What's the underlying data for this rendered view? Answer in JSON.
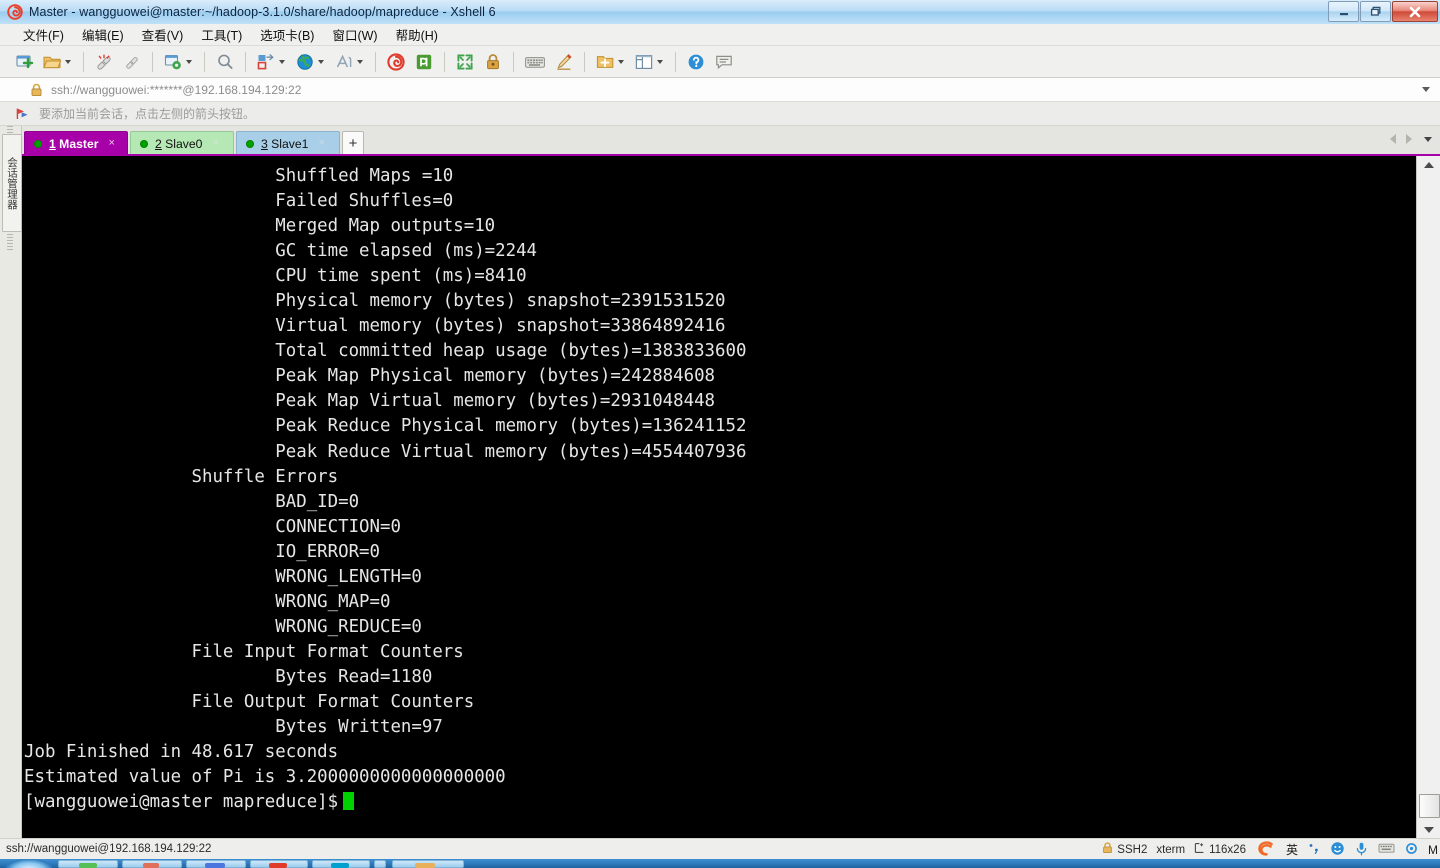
{
  "window": {
    "title": "Master - wangguowei@master:~/hadoop-3.1.0/share/hadoop/mapreduce - Xshell 6",
    "app_logo_icon": "xshell-spiral-logo-icon",
    "minimize_label": "–",
    "restore_label": "❐",
    "close_label": "✕"
  },
  "menubar": {
    "items": [
      {
        "label": "文件(F)",
        "name": "menu-file"
      },
      {
        "label": "编辑(E)",
        "name": "menu-edit"
      },
      {
        "label": "查看(V)",
        "name": "menu-view"
      },
      {
        "label": "工具(T)",
        "name": "menu-tools"
      },
      {
        "label": "选项卡(B)",
        "name": "menu-tabs"
      },
      {
        "label": "窗口(W)",
        "name": "menu-window"
      },
      {
        "label": "帮助(H)",
        "name": "menu-help"
      }
    ]
  },
  "toolbar": {
    "buttons": [
      {
        "name": "new-session-icon",
        "icon": "new-session",
        "has_caret": false
      },
      {
        "name": "open-folder-icon",
        "icon": "open-folder",
        "has_caret": true
      },
      {
        "sep": true
      },
      {
        "name": "disconnect-icon",
        "icon": "disconnect",
        "has_caret": false
      },
      {
        "name": "reconnect-icon",
        "icon": "reconnect-chain",
        "has_caret": false
      },
      {
        "sep": true
      },
      {
        "name": "session-properties-icon",
        "icon": "properties-gear",
        "has_caret": true
      },
      {
        "sep": true
      },
      {
        "name": "find-icon",
        "icon": "magnifier",
        "has_caret": false
      },
      {
        "sep": true
      },
      {
        "name": "transfer-icon",
        "icon": "file-transfer",
        "has_caret": true
      },
      {
        "name": "globe-icon",
        "icon": "globe",
        "has_caret": true
      },
      {
        "name": "font-icon",
        "icon": "font-A",
        "has_caret": true
      },
      {
        "sep": true
      },
      {
        "name": "xshell-icon",
        "icon": "xshell-spiral",
        "has_caret": false
      },
      {
        "name": "xftp-icon",
        "icon": "xftp-green",
        "has_caret": false
      },
      {
        "sep": true
      },
      {
        "name": "fullscreen-icon",
        "icon": "fullscreen-arrows",
        "has_caret": false
      },
      {
        "name": "lock-icon",
        "icon": "padlock",
        "has_caret": false
      },
      {
        "sep": true
      },
      {
        "name": "keyboard-icon",
        "icon": "keyboard",
        "has_caret": false
      },
      {
        "name": "highlight-pen-icon",
        "icon": "pen-highlight",
        "has_caret": false
      },
      {
        "sep": true
      },
      {
        "name": "add-to-folder-icon",
        "icon": "folder-plus",
        "has_caret": true
      },
      {
        "name": "layout-icon",
        "icon": "split-layout",
        "has_caret": true
      },
      {
        "sep": true
      },
      {
        "name": "help-icon",
        "icon": "help-question",
        "has_caret": false
      },
      {
        "name": "feedback-icon",
        "icon": "speech-bubble",
        "has_caret": false
      }
    ]
  },
  "address_bar": {
    "lock_icon": "padlock-icon",
    "value": "ssh://wangguowei:*******@192.168.194.129:22",
    "placeholder": "ssh://",
    "dropdown_icon": "chevron-down-icon"
  },
  "notice_bar": {
    "icon": "bookmark-flag-icon",
    "text": "要添加当前会话，点击左侧的箭头按钮。"
  },
  "left_rail": {
    "panel_label": "会话管理器"
  },
  "tabbar": {
    "tabs": [
      {
        "index": "1",
        "label": "Master",
        "color": "#a800a8",
        "active": true,
        "close_label": "×",
        "status": "connected"
      },
      {
        "index": "2",
        "label": "Slave0",
        "color": "#b5e8b5",
        "active": false,
        "close_label": "×",
        "status": "connected"
      },
      {
        "index": "3",
        "label": "Slave1",
        "color": "#a9cfe8",
        "active": false,
        "close_label": "×",
        "status": "connected"
      }
    ],
    "new_tab_label": "+",
    "prev_icon": "triangle-left-icon",
    "next_icon": "triangle-right-icon",
    "menu_icon": "chevron-down-icon",
    "accent_color": "#a800a8"
  },
  "terminal": {
    "rows": 26,
    "cols": 116,
    "background": "#000000",
    "foreground": "#e6e6e6",
    "cursor_color": "#00d200",
    "lines": [
      "                        Shuffled Maps =10",
      "                        Failed Shuffles=0",
      "                        Merged Map outputs=10",
      "                        GC time elapsed (ms)=2244",
      "                        CPU time spent (ms)=8410",
      "                        Physical memory (bytes) snapshot=2391531520",
      "                        Virtual memory (bytes) snapshot=33864892416",
      "                        Total committed heap usage (bytes)=1383833600",
      "                        Peak Map Physical memory (bytes)=242884608",
      "                        Peak Map Virtual memory (bytes)=2931048448",
      "                        Peak Reduce Physical memory (bytes)=136241152",
      "                        Peak Reduce Virtual memory (bytes)=4554407936",
      "                Shuffle Errors",
      "                        BAD_ID=0",
      "                        CONNECTION=0",
      "                        IO_ERROR=0",
      "                        WRONG_LENGTH=0",
      "                        WRONG_MAP=0",
      "                        WRONG_REDUCE=0",
      "                File Input Format Counters ",
      "                        Bytes Read=1180",
      "                File Output Format Counters ",
      "                        Bytes Written=97",
      "Job Finished in 48.617 seconds",
      "Estimated value of Pi is 3.2000000000000000000"
    ],
    "prompt": "[wangguowei@master mapreduce]$"
  },
  "scrollbar": {
    "up_icon": "arrow-up-icon",
    "down_icon": "arrow-down-icon",
    "thumb_position": "bottom"
  },
  "statusbar": {
    "connection": "ssh://wangguowei@192.168.194.129:22",
    "lock_icon": "padlock-icon",
    "protocol": "SSH2",
    "term_type": "xterm",
    "size_icon": "resize-icon",
    "size": "116x26",
    "ime_logo_icon": "sogou-ime-icon",
    "ime_mode": "英",
    "ime_punct_icon": "punctuation-icon",
    "ime_face_icon": "emoji-icon",
    "ime_voice_icon": "voice-input-icon",
    "ime_keyboard_icon": "soft-keyboard-icon",
    "ime_settings_icon": "ime-settings-icon",
    "ime_extra": "M"
  },
  "taskbar": {
    "start_label": "",
    "items": [
      "task-1",
      "task-2",
      "task-3",
      "task-4",
      "task-5",
      "task-6",
      "task-7"
    ]
  }
}
